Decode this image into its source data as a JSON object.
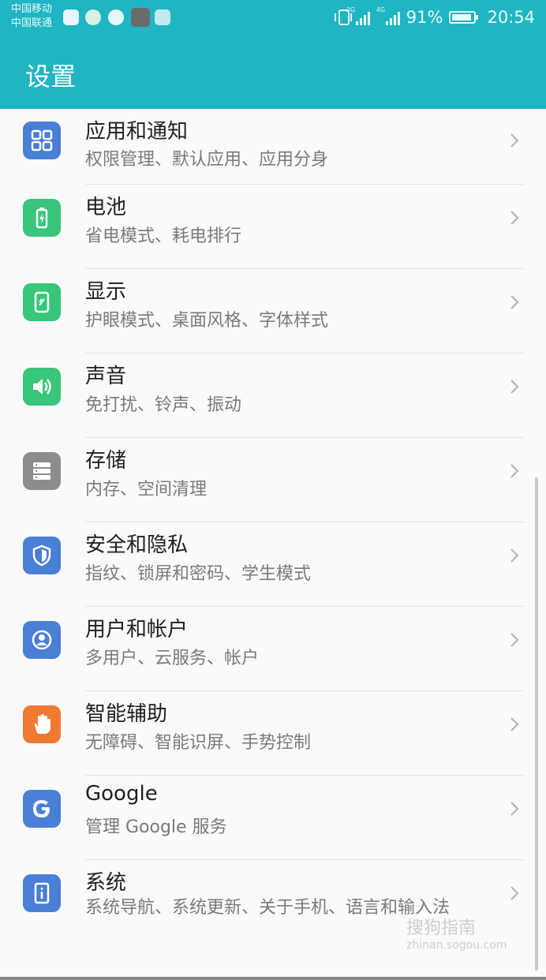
{
  "statusbar": {
    "carrier1": "中国移动",
    "carrier2": "中国联通",
    "sig1_label": "2G",
    "sig2_label": "4G",
    "battery_pct": "91%",
    "battery_level": 0.91,
    "time": "20:54"
  },
  "header": {
    "title": "设置",
    "bg": "#1fb5c2"
  },
  "items": [
    {
      "title": "应用和通知",
      "subtitle": "权限管理、默认应用、应用分身",
      "icon": "apps-grid-icon",
      "color": "#4a7fd6"
    },
    {
      "title": "电池",
      "subtitle": "省电模式、耗电排行",
      "icon": "battery-icon",
      "color": "#39c57a"
    },
    {
      "title": "显示",
      "subtitle": "护眼模式、桌面风格、字体样式",
      "icon": "display-icon",
      "color": "#39c57a"
    },
    {
      "title": "声音",
      "subtitle": "免打扰、铃声、振动",
      "icon": "speaker-icon",
      "color": "#39c57a"
    },
    {
      "title": "存储",
      "subtitle": "内存、空间清理",
      "icon": "storage-icon",
      "color": "#8c8c8c"
    },
    {
      "title": "安全和隐私",
      "subtitle": "指纹、锁屏和密码、学生模式",
      "icon": "shield-icon",
      "color": "#4a7fd6"
    },
    {
      "title": "用户和帐户",
      "subtitle": "多用户、云服务、帐户",
      "icon": "user-icon",
      "color": "#4a7fd6"
    },
    {
      "title": "智能辅助",
      "subtitle": "无障碍、智能识屏、手势控制",
      "icon": "hand-icon",
      "color": "#f07a32"
    },
    {
      "title": "Google",
      "subtitle": "管理 Google 服务",
      "icon": "google-icon",
      "color": "#4a7fd6"
    },
    {
      "title": "系统",
      "subtitle": "系统导航、系统更新、关于手机、语言和输入法",
      "icon": "phone-info-icon",
      "color": "#4a7fd6"
    }
  ],
  "watermark": {
    "main": "搜狗指南",
    "sub": "zhinan.sogou.com"
  }
}
